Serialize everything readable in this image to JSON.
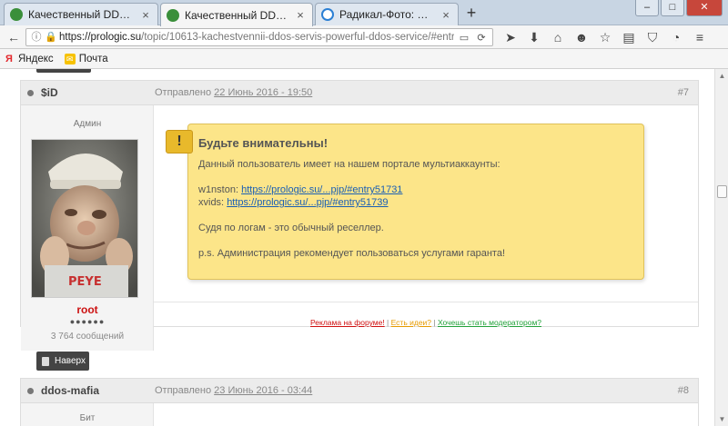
{
  "browser": {
    "tabs": [
      {
        "label": "Качественный DDoS-серв...",
        "favicon": "green",
        "active": false
      },
      {
        "label": "Качественный DDoS-серв...",
        "favicon": "green",
        "active": true
      },
      {
        "label": "Радикал-Фото: фото- и ви...",
        "favicon": "blue",
        "active": false
      }
    ],
    "new_tab_label": "+",
    "url_domain": "https://prologic.su",
    "url_path": "/topic/10613-kachestvennii-ddos-servis-powerful-ddos-service/#entry51856",
    "bookmarks": [
      {
        "label": "Яндекс",
        "icon": "yandex-icon"
      },
      {
        "label": "Почта",
        "icon": "mail-icon"
      }
    ]
  },
  "posts": [
    {
      "author": "$iD",
      "posted_prefix": "Отправлено",
      "posted_date": "22 Июнь 2016 - 19:50",
      "number": "#7",
      "group": "Админ",
      "username": "root",
      "rank_pips": "●●●●●●",
      "message_count": "3 764 сообщений",
      "notice": {
        "title": "Будьте внимательны!",
        "intro": "Данный пользователь имеет на нашем портале мультиаккаунты:",
        "accounts": [
          {
            "name": "w1nston:",
            "link": "https://prologic.su/...pjp/#entry51731"
          },
          {
            "name": "xvids:",
            "link": "https://prologic.su/...pjp/#entry51739"
          }
        ],
        "verdict": "Судя по логам - это обычный реселлер.",
        "ps": "p.s. Администрация рекомендует пользоваться услугами гаранта!"
      },
      "ads": {
        "link1": "Реклама на форуме!",
        "sep": " | ",
        "link2": "Есть идеи?",
        "link3": "Хочешь стать модератором?"
      }
    },
    {
      "author": "ddos-mafia",
      "posted_prefix": "Отправлено",
      "posted_date": "23 Июнь 2016 - 03:44",
      "number": "#8",
      "group": "Бит"
    }
  ],
  "up_button": "Наверх",
  "colors": {
    "notice_bg": "#fce589",
    "username": "#cc1111",
    "link": "#1a5fb4"
  }
}
